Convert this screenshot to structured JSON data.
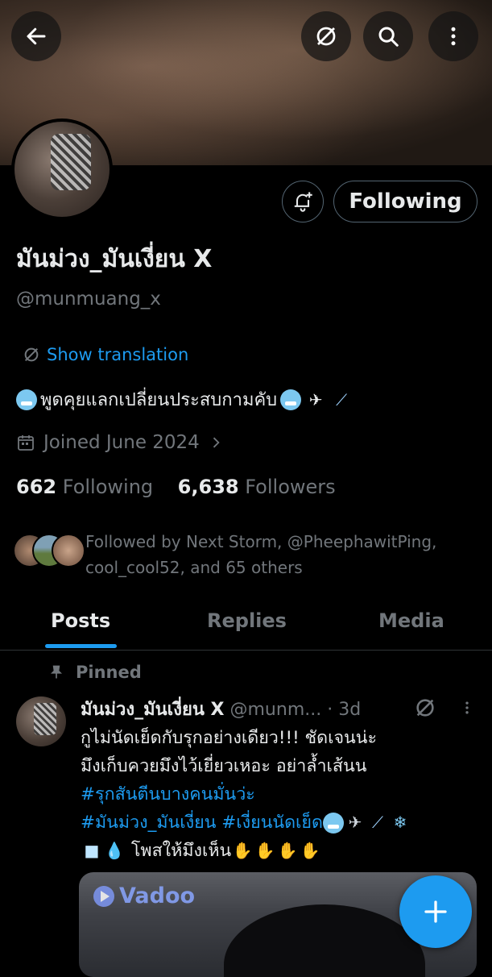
{
  "header": {
    "back_icon": "arrow-left-icon",
    "translate_icon": "translate-globe-icon",
    "search_icon": "search-icon",
    "more_icon": "more-vertical-icon"
  },
  "profile": {
    "following_button": "Following",
    "notify_icon": "bell-plus-icon",
    "display_name": "มันม่วง_มันเงี่ยน X",
    "handle": "@munmuang_x",
    "show_translation": "Show translation",
    "bio_text": "พูดคุยแลกเปลี่ยนประสบกามคับ",
    "joined": "Joined June 2024",
    "following_count": "662",
    "following_label": "Following",
    "followers_count": "6,638",
    "followers_label": "Followers",
    "followed_by": "Followed by Next Storm, @PheephawitPing, cool_cool52, and 65 others"
  },
  "tabs": [
    {
      "label": "Posts",
      "active": true
    },
    {
      "label": "Replies",
      "active": false
    },
    {
      "label": "Media",
      "active": false
    }
  ],
  "post": {
    "pinned_label": "Pinned",
    "author_name": "มันม่วง_มันเงี่ยน X",
    "author_handle": "@munm...",
    "time": "· 3d",
    "line1": "กูไม่นัดเย็ดกับรุกอย่างเดียว!!! ชัดเจนน่ะ",
    "line2": "มึงเก็บควยมึงไว้เยี่ยวเหอะ  อย่าล้ำเส้นน",
    "hashtag1": "#รุกสันตีนบางคนมั่นว่ะ",
    "hashtag2": "#มันม่วง_มันเงี่ยน",
    "hashtag3": "#เงี่ยนนัดเย็ด",
    "line5_text": "โพสให้มึงเห็น",
    "media_watermark": "Vadoo"
  },
  "fab": {
    "icon": "plus-icon"
  },
  "colors": {
    "accent": "#1d9bf0",
    "muted": "#71767b",
    "text": "#e7e9ea",
    "border": "#2f3336"
  }
}
